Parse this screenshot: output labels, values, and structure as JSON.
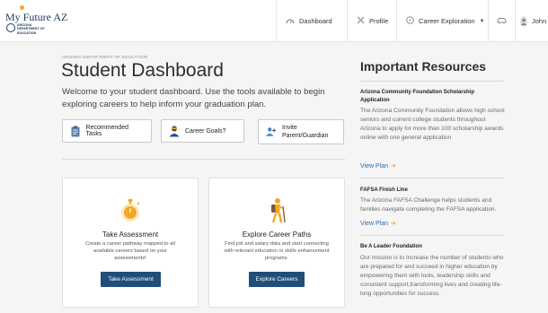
{
  "header": {
    "logo_title": "My Future AZ",
    "logo_subtitle": "ARIZONA DEPARTMENT OF EDUCATION",
    "nav": {
      "dashboard": "Dashboard",
      "profile": "Profile",
      "career_exploration": "Career Exploration",
      "user": "John"
    },
    "icons": {
      "dashboard": "gauge-icon",
      "profile": "tools-icon",
      "career": "compass-icon",
      "car": "car-icon",
      "user": "user-icon"
    }
  },
  "main": {
    "kicker": "ARIZONA DEPARTMENT OF EDUCATION",
    "title": "Student Dashboard",
    "welcome": "Welcome to your student dashboard. Use the tools available to begin exploring careers to help inform your graduation plan.",
    "actions": [
      {
        "label": "Recommended Tasks",
        "icon": "clipboard-icon"
      },
      {
        "label": "Career Goals?",
        "icon": "person-icon"
      },
      {
        "label": "Invite Parent/Guardian",
        "icon": "add-person-icon"
      }
    ],
    "cards": [
      {
        "title": "Take Assessment",
        "text": "Create a career pathway mapped to all available careers based on your assessments!",
        "button": "Take Assessment",
        "icon": "stopwatch-icon"
      },
      {
        "title": "Explore Career Paths",
        "text": "Find job and salary data and start connecting with relevant education or skills enhancement programs.",
        "button": "Explore Careers",
        "icon": "hiker-icon"
      }
    ]
  },
  "resources": {
    "title": "Important Resources",
    "link_label": "View Plan",
    "items": [
      {
        "heading": "Arizona Community Foundation Scholarship Application",
        "body": "The Arizona Community Foundation allows high school seniors and current college students throughout Arizona to apply for more than 100 scholarship awards online with one general application"
      },
      {
        "heading": "FAFSA Finish Line",
        "body": "The Arizona FAFSA Challenge helps students and families navigate completing the FAFSA application."
      },
      {
        "heading": "Be A Leader Foundation",
        "body": "Our mission is to Increase the number of students who are prepared for and succeed in higher education by empowering them with tools, leadership skills and consistent support,transforming lives and creating life-long opportunities for success."
      }
    ]
  },
  "colors": {
    "primary_button": "#1f4e79",
    "link": "#2a6fb0",
    "accent": "#f5a623",
    "background": "#f5f5f5"
  }
}
